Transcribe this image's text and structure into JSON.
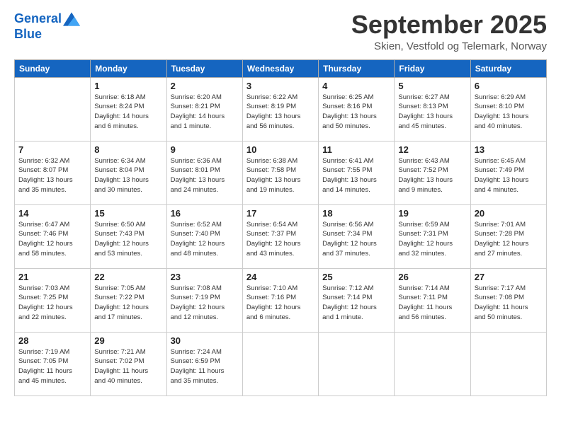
{
  "header": {
    "logo_line1": "General",
    "logo_line2": "Blue",
    "month": "September 2025",
    "location": "Skien, Vestfold og Telemark, Norway"
  },
  "weekdays": [
    "Sunday",
    "Monday",
    "Tuesday",
    "Wednesday",
    "Thursday",
    "Friday",
    "Saturday"
  ],
  "weeks": [
    [
      {
        "day": "",
        "info": ""
      },
      {
        "day": "1",
        "info": "Sunrise: 6:18 AM\nSunset: 8:24 PM\nDaylight: 14 hours\nand 6 minutes."
      },
      {
        "day": "2",
        "info": "Sunrise: 6:20 AM\nSunset: 8:21 PM\nDaylight: 14 hours\nand 1 minute."
      },
      {
        "day": "3",
        "info": "Sunrise: 6:22 AM\nSunset: 8:19 PM\nDaylight: 13 hours\nand 56 minutes."
      },
      {
        "day": "4",
        "info": "Sunrise: 6:25 AM\nSunset: 8:16 PM\nDaylight: 13 hours\nand 50 minutes."
      },
      {
        "day": "5",
        "info": "Sunrise: 6:27 AM\nSunset: 8:13 PM\nDaylight: 13 hours\nand 45 minutes."
      },
      {
        "day": "6",
        "info": "Sunrise: 6:29 AM\nSunset: 8:10 PM\nDaylight: 13 hours\nand 40 minutes."
      }
    ],
    [
      {
        "day": "7",
        "info": "Sunrise: 6:32 AM\nSunset: 8:07 PM\nDaylight: 13 hours\nand 35 minutes."
      },
      {
        "day": "8",
        "info": "Sunrise: 6:34 AM\nSunset: 8:04 PM\nDaylight: 13 hours\nand 30 minutes."
      },
      {
        "day": "9",
        "info": "Sunrise: 6:36 AM\nSunset: 8:01 PM\nDaylight: 13 hours\nand 24 minutes."
      },
      {
        "day": "10",
        "info": "Sunrise: 6:38 AM\nSunset: 7:58 PM\nDaylight: 13 hours\nand 19 minutes."
      },
      {
        "day": "11",
        "info": "Sunrise: 6:41 AM\nSunset: 7:55 PM\nDaylight: 13 hours\nand 14 minutes."
      },
      {
        "day": "12",
        "info": "Sunrise: 6:43 AM\nSunset: 7:52 PM\nDaylight: 13 hours\nand 9 minutes."
      },
      {
        "day": "13",
        "info": "Sunrise: 6:45 AM\nSunset: 7:49 PM\nDaylight: 13 hours\nand 4 minutes."
      }
    ],
    [
      {
        "day": "14",
        "info": "Sunrise: 6:47 AM\nSunset: 7:46 PM\nDaylight: 12 hours\nand 58 minutes."
      },
      {
        "day": "15",
        "info": "Sunrise: 6:50 AM\nSunset: 7:43 PM\nDaylight: 12 hours\nand 53 minutes."
      },
      {
        "day": "16",
        "info": "Sunrise: 6:52 AM\nSunset: 7:40 PM\nDaylight: 12 hours\nand 48 minutes."
      },
      {
        "day": "17",
        "info": "Sunrise: 6:54 AM\nSunset: 7:37 PM\nDaylight: 12 hours\nand 43 minutes."
      },
      {
        "day": "18",
        "info": "Sunrise: 6:56 AM\nSunset: 7:34 PM\nDaylight: 12 hours\nand 37 minutes."
      },
      {
        "day": "19",
        "info": "Sunrise: 6:59 AM\nSunset: 7:31 PM\nDaylight: 12 hours\nand 32 minutes."
      },
      {
        "day": "20",
        "info": "Sunrise: 7:01 AM\nSunset: 7:28 PM\nDaylight: 12 hours\nand 27 minutes."
      }
    ],
    [
      {
        "day": "21",
        "info": "Sunrise: 7:03 AM\nSunset: 7:25 PM\nDaylight: 12 hours\nand 22 minutes."
      },
      {
        "day": "22",
        "info": "Sunrise: 7:05 AM\nSunset: 7:22 PM\nDaylight: 12 hours\nand 17 minutes."
      },
      {
        "day": "23",
        "info": "Sunrise: 7:08 AM\nSunset: 7:19 PM\nDaylight: 12 hours\nand 12 minutes."
      },
      {
        "day": "24",
        "info": "Sunrise: 7:10 AM\nSunset: 7:16 PM\nDaylight: 12 hours\nand 6 minutes."
      },
      {
        "day": "25",
        "info": "Sunrise: 7:12 AM\nSunset: 7:14 PM\nDaylight: 12 hours\nand 1 minute."
      },
      {
        "day": "26",
        "info": "Sunrise: 7:14 AM\nSunset: 7:11 PM\nDaylight: 11 hours\nand 56 minutes."
      },
      {
        "day": "27",
        "info": "Sunrise: 7:17 AM\nSunset: 7:08 PM\nDaylight: 11 hours\nand 50 minutes."
      }
    ],
    [
      {
        "day": "28",
        "info": "Sunrise: 7:19 AM\nSunset: 7:05 PM\nDaylight: 11 hours\nand 45 minutes."
      },
      {
        "day": "29",
        "info": "Sunrise: 7:21 AM\nSunset: 7:02 PM\nDaylight: 11 hours\nand 40 minutes."
      },
      {
        "day": "30",
        "info": "Sunrise: 7:24 AM\nSunset: 6:59 PM\nDaylight: 11 hours\nand 35 minutes."
      },
      {
        "day": "",
        "info": ""
      },
      {
        "day": "",
        "info": ""
      },
      {
        "day": "",
        "info": ""
      },
      {
        "day": "",
        "info": ""
      }
    ]
  ]
}
